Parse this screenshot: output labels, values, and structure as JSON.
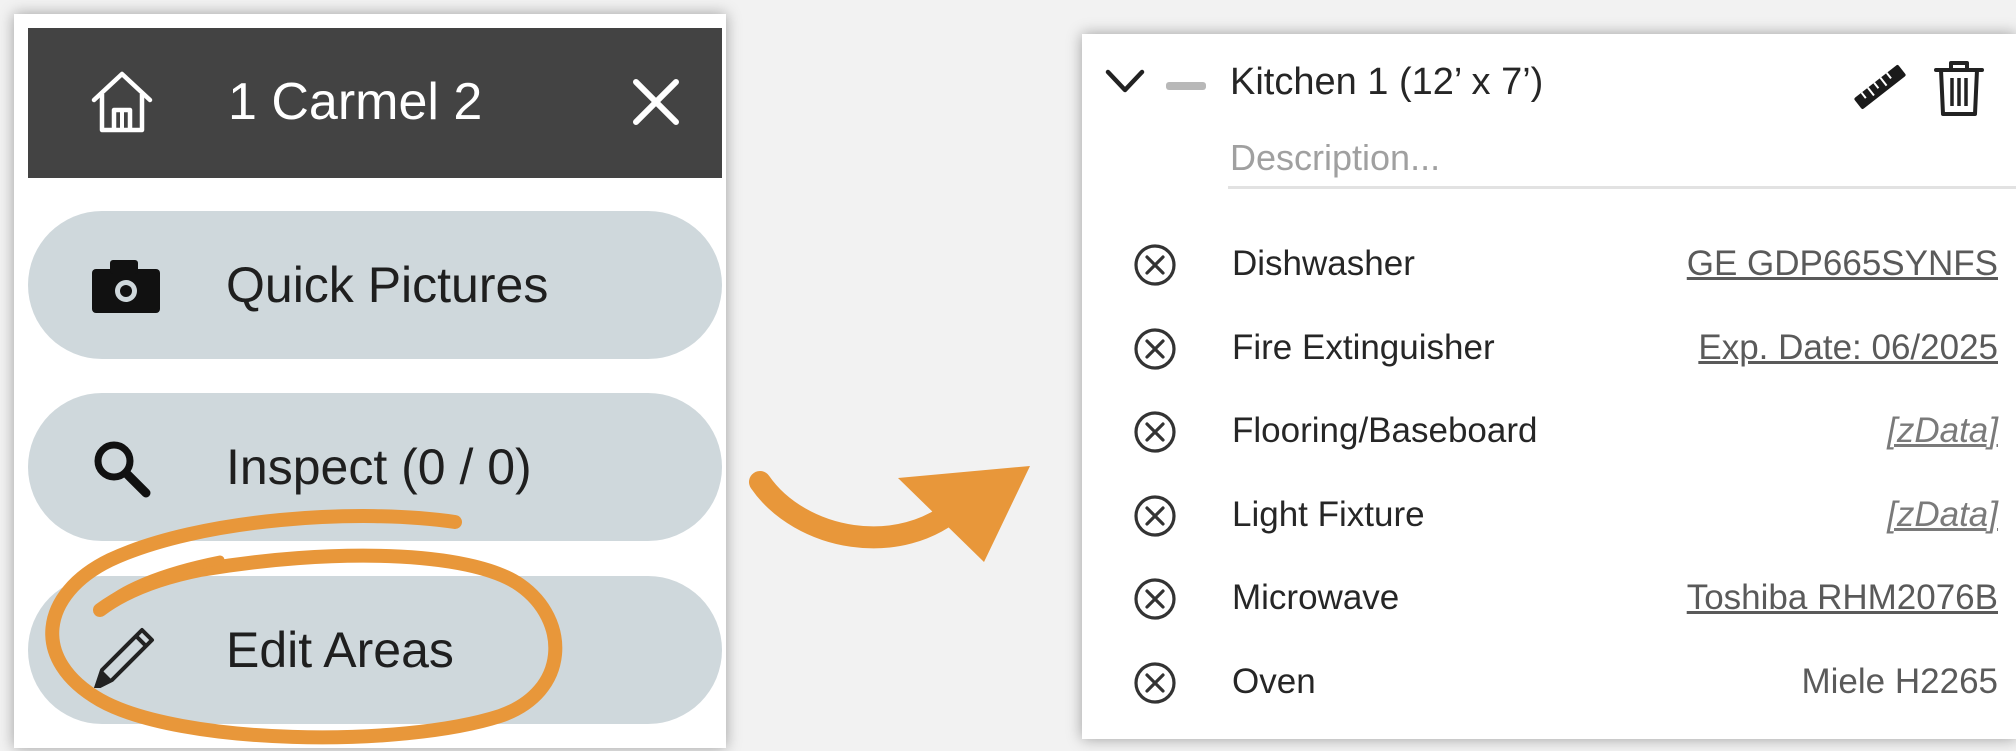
{
  "menu": {
    "title": "1 Carmel 2",
    "icons": {
      "home": "home-icon",
      "close": "close-icon"
    },
    "items": [
      {
        "label": "Quick Pictures",
        "icon": "camera-icon"
      },
      {
        "label": "Inspect (0 / 0)",
        "icon": "search-icon"
      },
      {
        "label": "Edit Areas",
        "icon": "pencil-icon",
        "highlighted": true
      }
    ]
  },
  "annotation": {
    "color": "#e8973a",
    "shapes": [
      "circle-highlight",
      "curved-arrow"
    ]
  },
  "area": {
    "title": "Kitchen 1 (12’ x 7’)",
    "description_placeholder": "Description...",
    "description_value": "",
    "icons": {
      "expand": "chevron-down-icon",
      "collapse": "minus-icon",
      "measure": "ruler-icon",
      "delete": "trash-icon",
      "remove_item": "remove-circle-icon"
    },
    "items": [
      {
        "name": "Dishwasher",
        "value": "GE GDP665SYNFS",
        "style": "link"
      },
      {
        "name": "Fire Extinguisher",
        "value": "Exp. Date: 06/2025",
        "style": "link"
      },
      {
        "name": "Flooring/Baseboard",
        "value": "[zData]",
        "style": "italic"
      },
      {
        "name": "Light Fixture",
        "value": "[zData]",
        "style": "italic"
      },
      {
        "name": "Microwave",
        "value": "Toshiba RHM2076B",
        "style": "link"
      },
      {
        "name": "Oven",
        "value": "Miele H2265",
        "style": "plain"
      }
    ]
  },
  "colors": {
    "header_bg": "#434343",
    "button_bg": "#cfd8dc",
    "accent": "#e8973a"
  }
}
